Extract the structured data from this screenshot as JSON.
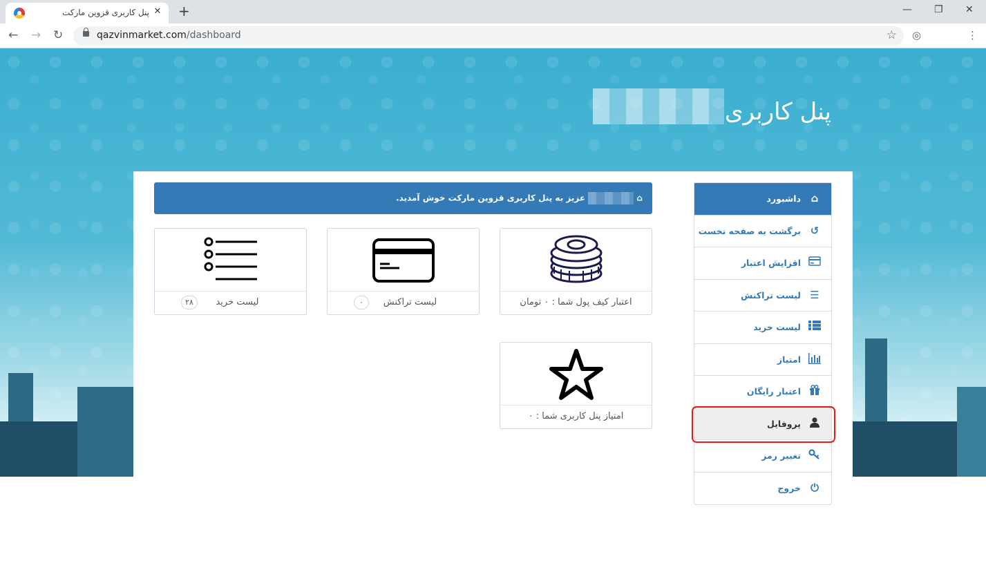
{
  "browser": {
    "tab_title": "پنل کاربری قزوین مارکت",
    "url_host": "qazvinmarket.com",
    "url_path": "/dashboard",
    "icons": [
      "favicon",
      "close-icon",
      "new-tab-icon",
      "minimize-icon",
      "restore-icon",
      "window-close-icon",
      "back-icon",
      "forward-icon",
      "reload-icon",
      "lock-icon",
      "star-icon",
      "incognito-icon",
      "menu-icon"
    ]
  },
  "header": {
    "title": "پنل کاربری"
  },
  "welcome": {
    "text": "عزیز به پنل کاربری قزوین مارکت خوش آمدید."
  },
  "cards": {
    "wallet": {
      "label": "اعتبار کیف پول شما : ۰ تومان",
      "icon": "coins-icon"
    },
    "transactions": {
      "label": "لیست تراکنش",
      "badge": "۰",
      "icon": "credit-card-icon"
    },
    "purchases": {
      "label": "لیست خرید",
      "badge": "۲۸",
      "icon": "list-icon"
    },
    "points": {
      "label": "امتیاز پنل کاربری شما : ۰",
      "icon": "star-icon"
    }
  },
  "sidebar": {
    "items": [
      {
        "label": "داشبورد",
        "icon": "home-icon"
      },
      {
        "label": "برگشت به صفحه نخست",
        "icon": "undo-icon"
      },
      {
        "label": "افزایش اعتبار",
        "icon": "credit-card-icon"
      },
      {
        "label": "لیست تراکنش",
        "icon": "list-icon"
      },
      {
        "label": "لیست خرید",
        "icon": "th-list-icon"
      },
      {
        "label": "امتیاز",
        "icon": "bar-chart-icon"
      },
      {
        "label": "اعتبار رایگان",
        "icon": "gift-icon"
      },
      {
        "label": "پروفایل",
        "icon": "user-icon"
      },
      {
        "label": "تغییر رمز",
        "icon": "key-icon"
      },
      {
        "label": "خروج",
        "icon": "power-icon"
      }
    ]
  },
  "colors": {
    "primary": "#337ab7",
    "hero": "#3aaed0",
    "highlight": "#e31b1b"
  }
}
